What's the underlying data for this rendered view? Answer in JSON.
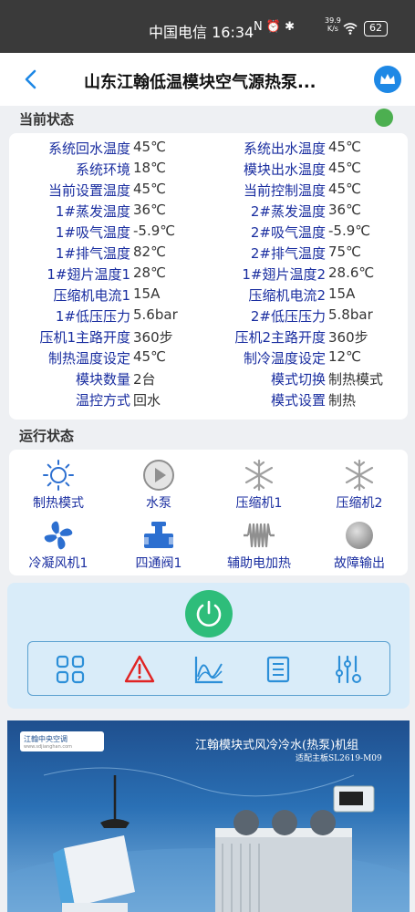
{
  "status_bar": {
    "carrier_time": "中国电信 16:34",
    "speed_value": "39.9",
    "speed_unit": "K/s",
    "battery": "62"
  },
  "header": {
    "title": "山东江翰低温模块空气源热泵..."
  },
  "current_state": {
    "title": "当前状态",
    "online_color": "#4caf50",
    "rows": [
      {
        "l1": "系统回水温度",
        "v1": "45℃",
        "l2": "系统出水温度",
        "v2": "45℃"
      },
      {
        "l1": "系统环境",
        "v1": "18℃",
        "l2": "模块出水温度",
        "v2": "45℃"
      },
      {
        "l1": "当前设置温度",
        "v1": "45℃",
        "l2": "当前控制温度",
        "v2": "45℃"
      },
      {
        "l1": "1#蒸发温度",
        "v1": "36℃",
        "l2": "2#蒸发温度",
        "v2": "36℃"
      },
      {
        "l1": "1#吸气温度",
        "v1": "-5.9℃",
        "l2": "2#吸气温度",
        "v2": "-5.9℃"
      },
      {
        "l1": "1#排气温度",
        "v1": "82℃",
        "l2": "2#排气温度",
        "v2": "75℃"
      },
      {
        "l1": "1#翅片温度1",
        "v1": "28℃",
        "l2": "1#翅片温度2",
        "v2": "28.6℃"
      },
      {
        "l1": "压缩机电流1",
        "v1": "15A",
        "l2": "压缩机电流2",
        "v2": "15A"
      },
      {
        "l1": "1#低压压力",
        "v1": "5.6bar",
        "l2": "2#低压压力",
        "v2": "5.8bar"
      },
      {
        "l1": "压机1主路开度",
        "v1": "360步",
        "l2": "压机2主路开度",
        "v2": "360步"
      },
      {
        "l1": "制热温度设定",
        "v1": "45℃",
        "l2": "制冷温度设定",
        "v2": "12℃"
      },
      {
        "l1": "模块数量",
        "v1": "2台",
        "l2": "模式切换",
        "v2": "制热模式"
      },
      {
        "l1": "温控方式",
        "v1": "回水",
        "l2": "模式设置",
        "v2": "制热"
      }
    ]
  },
  "run_state": {
    "title": "运行状态",
    "devices": [
      {
        "label": "制热模式",
        "icon": "sun-icon"
      },
      {
        "label": "水泵",
        "icon": "play-circle-icon"
      },
      {
        "label": "压缩机1",
        "icon": "snowflake-icon"
      },
      {
        "label": "压缩机2",
        "icon": "snowflake-icon"
      },
      {
        "label": "冷凝风机1",
        "icon": "fan-icon"
      },
      {
        "label": "四通阀1",
        "icon": "valve-icon"
      },
      {
        "label": "辅助电加热",
        "icon": "heater-coil-icon"
      },
      {
        "label": "故障输出",
        "icon": "fault-dot-icon"
      }
    ]
  },
  "controls": {
    "power_color": "#2ebd7a",
    "tools": [
      "grid-icon",
      "warning-icon",
      "curve-chart-icon",
      "list-icon",
      "settings-sliders-icon"
    ]
  },
  "banner": {
    "logo_text": "江翰中央空调",
    "logo_sub": "www.sdjianghan.com",
    "headline": "江翰模块式风冷冷水(热泵)机组",
    "subline": "适配主板SL2619-M09"
  }
}
